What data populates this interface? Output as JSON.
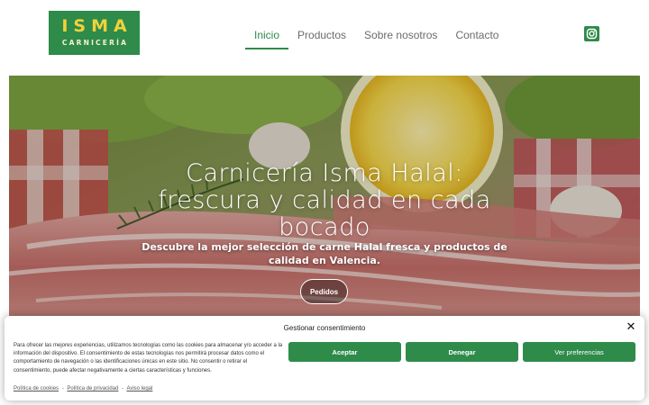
{
  "header": {
    "logo_main": "ISMA",
    "logo_sub": "CARNICERÍA",
    "nav": [
      {
        "label": "Inicio",
        "active": true
      },
      {
        "label": "Productos",
        "active": false
      },
      {
        "label": "Sobre nosotros",
        "active": false
      },
      {
        "label": "Contacto",
        "active": false
      }
    ],
    "social_icon": "instagram-icon"
  },
  "hero": {
    "title_line1": "Carnicería Isma Halal:",
    "title_line2": "frescura y calidad en cada",
    "title_line3": "bocado",
    "subtitle": "Descubre la mejor selección de carne Halal fresca y productos de calidad en Valencia.",
    "button_label": "Pedidos"
  },
  "consent": {
    "title": "Gestionar consentimiento",
    "text": "Para ofrecer las mejores experiencias, utilizamos tecnologías como las cookies para almacenar y/o acceder a la información del dispositivo. El consentimiento de estas tecnologías nos permitirá procesar datos como el comportamiento de navegación o las identificaciones únicas en este sitio. No consentir o retirar el consentimiento, puede afectar negativamente a ciertas características y funciones.",
    "accept_label": "Aceptar",
    "deny_label": "Denegar",
    "prefs_label": "Ver preferencias",
    "links": [
      "Política de cookies",
      "Política de privacidad",
      "Aviso legal"
    ],
    "link_separator": "-",
    "close_icon": "close-icon"
  },
  "colors": {
    "brand_green": "#2e8b4a",
    "logo_yellow": "#f1d23a",
    "nav_text": "#6b6b6b"
  }
}
